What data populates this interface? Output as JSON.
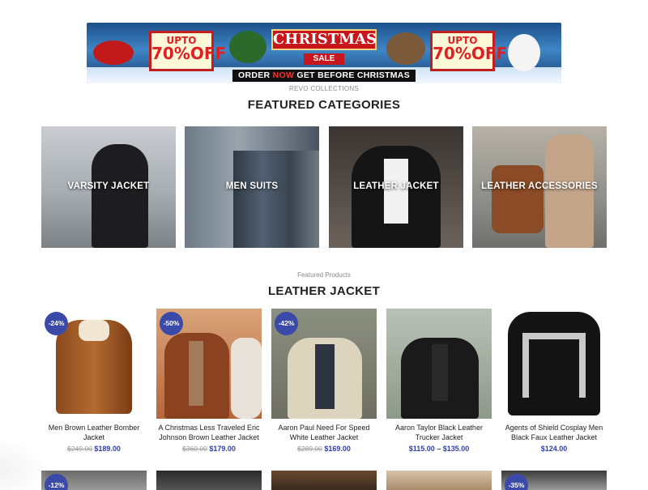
{
  "banner": {
    "promo_upto": "UPTO",
    "promo_pct": "70%OFF",
    "title": "CHRISTMAS",
    "sale": "SALE",
    "cta_before": "ORDER ",
    "cta_now": "NOW",
    "cta_after": " GET BEFORE CHRISTMAS"
  },
  "brand": "REVO COLLECTIONS",
  "featured_categories": {
    "heading": "FEATURED CATEGORIES",
    "items": [
      {
        "label": "VARSITY JACKET"
      },
      {
        "label": "MEN SUITS"
      },
      {
        "label": "LEATHER JACKET"
      },
      {
        "label": "LEATHER ACCESSORIES"
      }
    ]
  },
  "featured_products": {
    "kicker": "Featured Products",
    "heading": "LEATHER JACKET",
    "items": [
      {
        "badge": "-24%",
        "name": "Men Brown Leather Bomber Jacket",
        "old_price": "$249.00",
        "price": "$189.00"
      },
      {
        "badge": "-50%",
        "name": "A Christmas Less Traveled Eric Johnson Brown Leather Jacket",
        "old_price": "$360.00",
        "price": "$179.00"
      },
      {
        "badge": "-42%",
        "name": "Aaron Paul Need For Speed White Leather Jacket",
        "old_price": "$289.00",
        "price": "$169.00"
      },
      {
        "badge": "",
        "name": "Aaron Taylor Black Leather Trucker Jacket",
        "old_price": "",
        "price": "$115.00 – $135.00"
      },
      {
        "badge": "",
        "name": "Agents of Shield Cosplay Men Black Faux Leather Jacket",
        "old_price": "",
        "price": "$124.00"
      }
    ],
    "row2_badges": [
      "-12%",
      "",
      "",
      "",
      "-35%"
    ]
  },
  "colors": {
    "badge": "#3b4aa8",
    "price": "#2f3fa0",
    "banner_red": "#c8171c"
  }
}
